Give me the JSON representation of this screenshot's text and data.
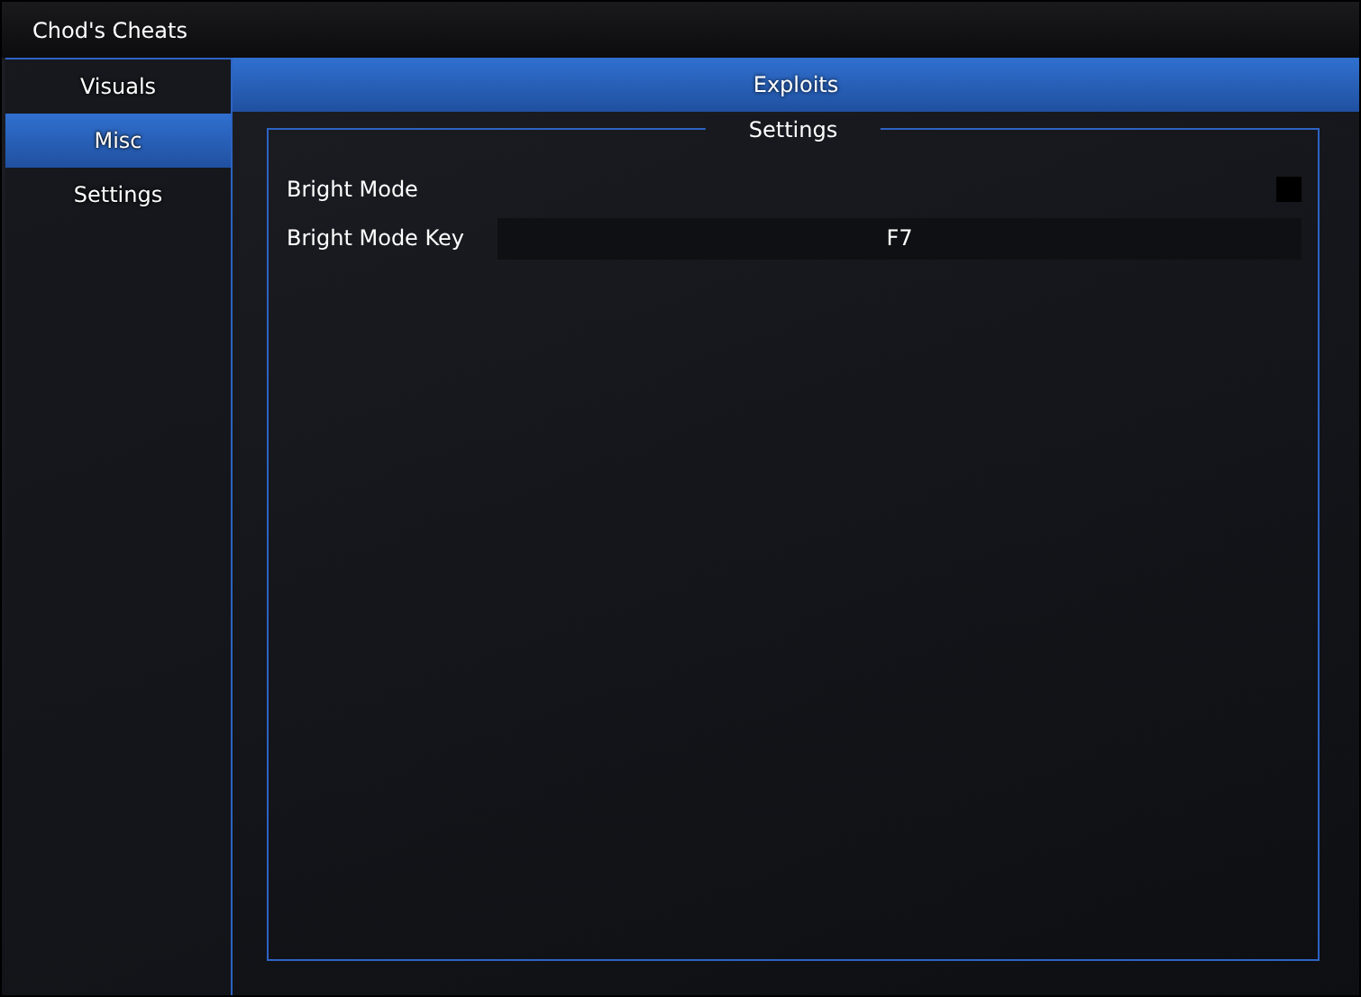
{
  "window": {
    "title": "Chod's Cheats"
  },
  "sidebar": {
    "items": [
      {
        "label": "Visuals",
        "selected": false
      },
      {
        "label": "Misc",
        "selected": true
      },
      {
        "label": "Settings",
        "selected": false
      }
    ]
  },
  "tabs": [
    {
      "label": "Exploits",
      "selected": true
    }
  ],
  "group": {
    "title": "Settings",
    "rows": [
      {
        "kind": "checkbox",
        "label": "Bright Mode",
        "checked": false
      },
      {
        "kind": "key",
        "label": "Bright Mode Key",
        "value": "F7"
      }
    ]
  }
}
